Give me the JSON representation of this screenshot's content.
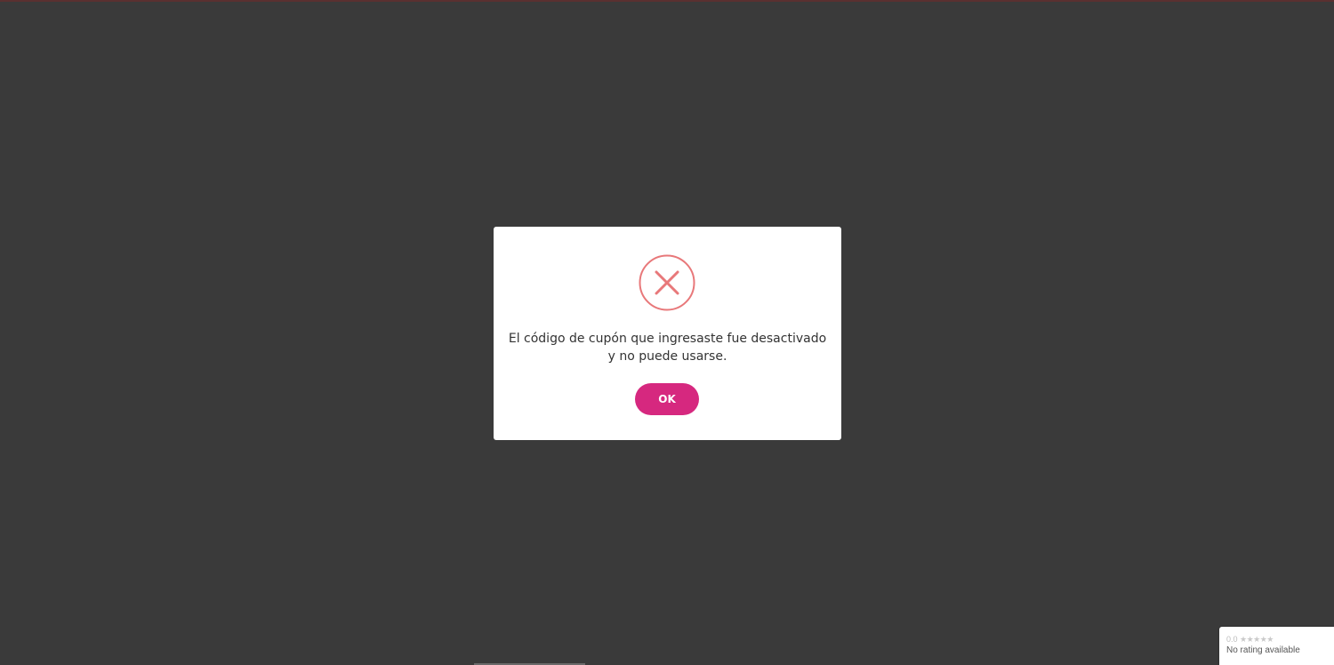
{
  "dialog": {
    "icon": "error-x-circle-icon",
    "message": "El código de cupón que ingresaste fue desactivado y no puede usarse.",
    "ok_label": "OK"
  },
  "rating_widget": {
    "score": "0.0",
    "stars": "★★★★★",
    "status": "No rating available"
  },
  "colors": {
    "backdrop": "#3a3a3a",
    "button": "#d6287f",
    "error_icon": "#e8787a"
  }
}
